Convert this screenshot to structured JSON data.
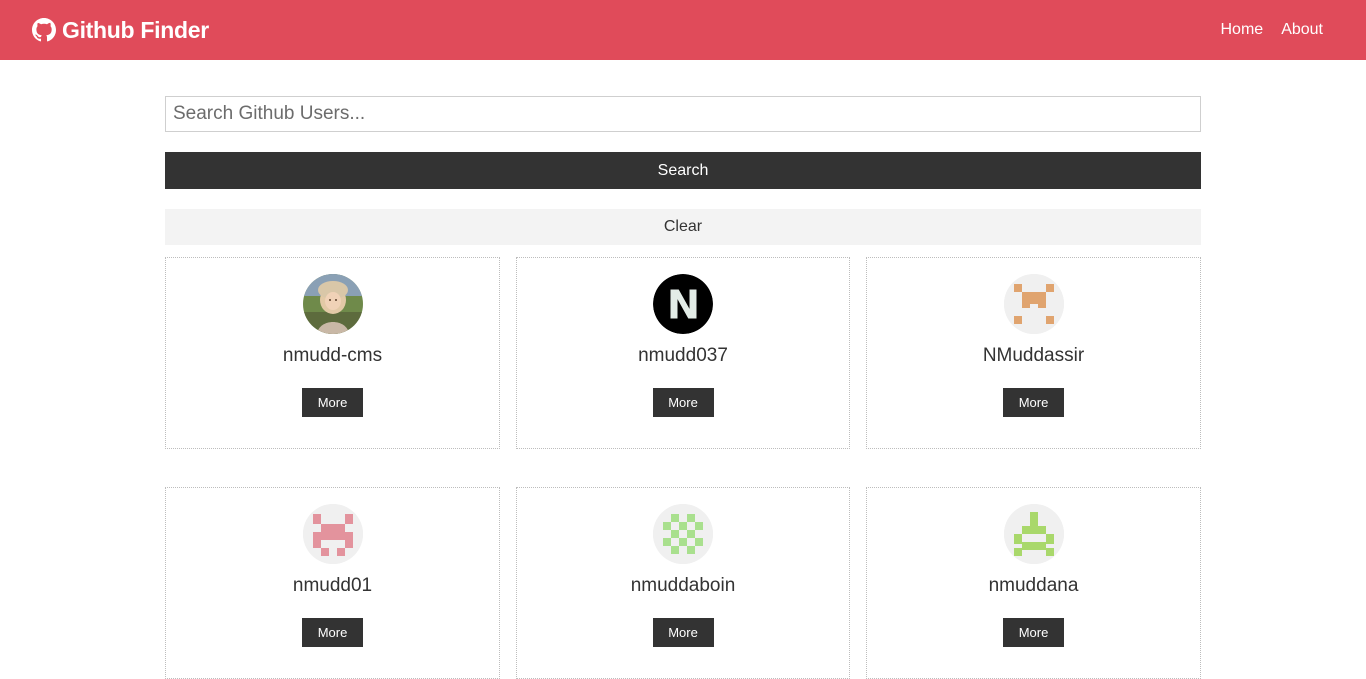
{
  "navbar": {
    "brand_icon": "github-icon",
    "title": "Github Finder",
    "links": [
      {
        "label": "Home"
      },
      {
        "label": "About"
      }
    ]
  },
  "search": {
    "placeholder": "Search Github Users...",
    "value": "",
    "search_label": "Search",
    "clear_label": "Clear"
  },
  "users": [
    {
      "login": "nmudd-cms",
      "more_label": "More",
      "avatar": "photo-avatar"
    },
    {
      "login": "nmudd037",
      "more_label": "More",
      "avatar": "letter-n-avatar"
    },
    {
      "login": "NMuddassir",
      "more_label": "More",
      "avatar": "identicon-orange"
    },
    {
      "login": "nmudd01",
      "more_label": "More",
      "avatar": "identicon-pink"
    },
    {
      "login": "nmuddaboin",
      "more_label": "More",
      "avatar": "identicon-green"
    },
    {
      "login": "nmuddana",
      "more_label": "More",
      "avatar": "identicon-lime"
    }
  ],
  "colors": {
    "navbar_bg": "#e04b5a",
    "dark_button": "#333333",
    "light_button": "#f3f3f3"
  }
}
